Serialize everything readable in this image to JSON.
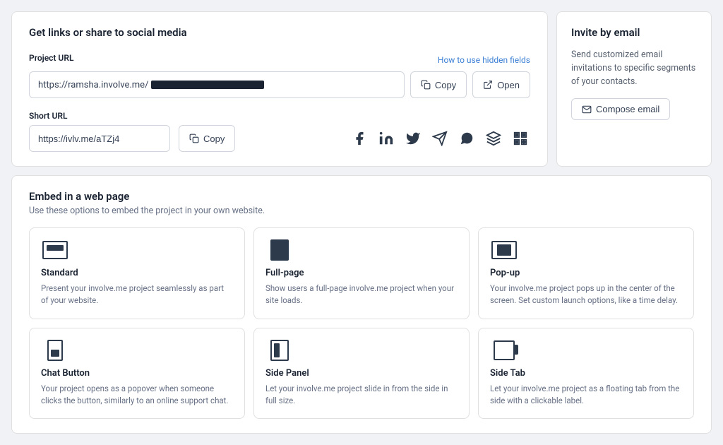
{
  "share_panel": {
    "title": "Get links or share to social media",
    "project_url_label": "Project URL",
    "hidden_fields_link": "How to use hidden fields",
    "project_url_value": "https://ramsha.involve.me/",
    "copy_btn_label": "Copy",
    "open_btn_label": "Open",
    "short_url_label": "Short URL",
    "short_url_value": "https://ivlv.me/aTZj4",
    "short_copy_btn_label": "Copy"
  },
  "invite_panel": {
    "title": "Invite by email",
    "description": "Send customized email invitations to specific segments of your contacts.",
    "compose_btn_label": "Compose email"
  },
  "embed_panel": {
    "title": "Embed in a web page",
    "subtitle": "Use these options to embed the project in your own website.",
    "cards": [
      {
        "id": "standard",
        "title": "Standard",
        "description": "Present your involve.me project seamlessly as part of your website."
      },
      {
        "id": "fullpage",
        "title": "Full-page",
        "description": "Show users a full-page involve.me project when your site loads."
      },
      {
        "id": "popup",
        "title": "Pop-up",
        "description": "Your involve.me project pops up in the center of the screen. Set custom launch options, like a time delay."
      },
      {
        "id": "chat",
        "title": "Chat Button",
        "description": "Your project opens as a popover when someone clicks the button, similarly to an online support chat."
      },
      {
        "id": "sidepanel",
        "title": "Side Panel",
        "description": "Let your involve.me project slide in from the side in full size."
      },
      {
        "id": "sidetab",
        "title": "Side Tab",
        "description": "Let your involve.me project as a floating tab from the side with a clickable label."
      }
    ]
  },
  "social_icons": [
    {
      "id": "facebook",
      "symbol": "f",
      "label": "Facebook"
    },
    {
      "id": "linkedin",
      "symbol": "in",
      "label": "LinkedIn"
    },
    {
      "id": "twitter",
      "symbol": "t",
      "label": "Twitter"
    },
    {
      "id": "telegram",
      "symbol": "✈",
      "label": "Telegram"
    },
    {
      "id": "whatsapp",
      "symbol": "w",
      "label": "WhatsApp"
    },
    {
      "id": "buffer",
      "symbol": "≡",
      "label": "Buffer"
    },
    {
      "id": "qr",
      "symbol": "⊞",
      "label": "QR Code"
    }
  ]
}
